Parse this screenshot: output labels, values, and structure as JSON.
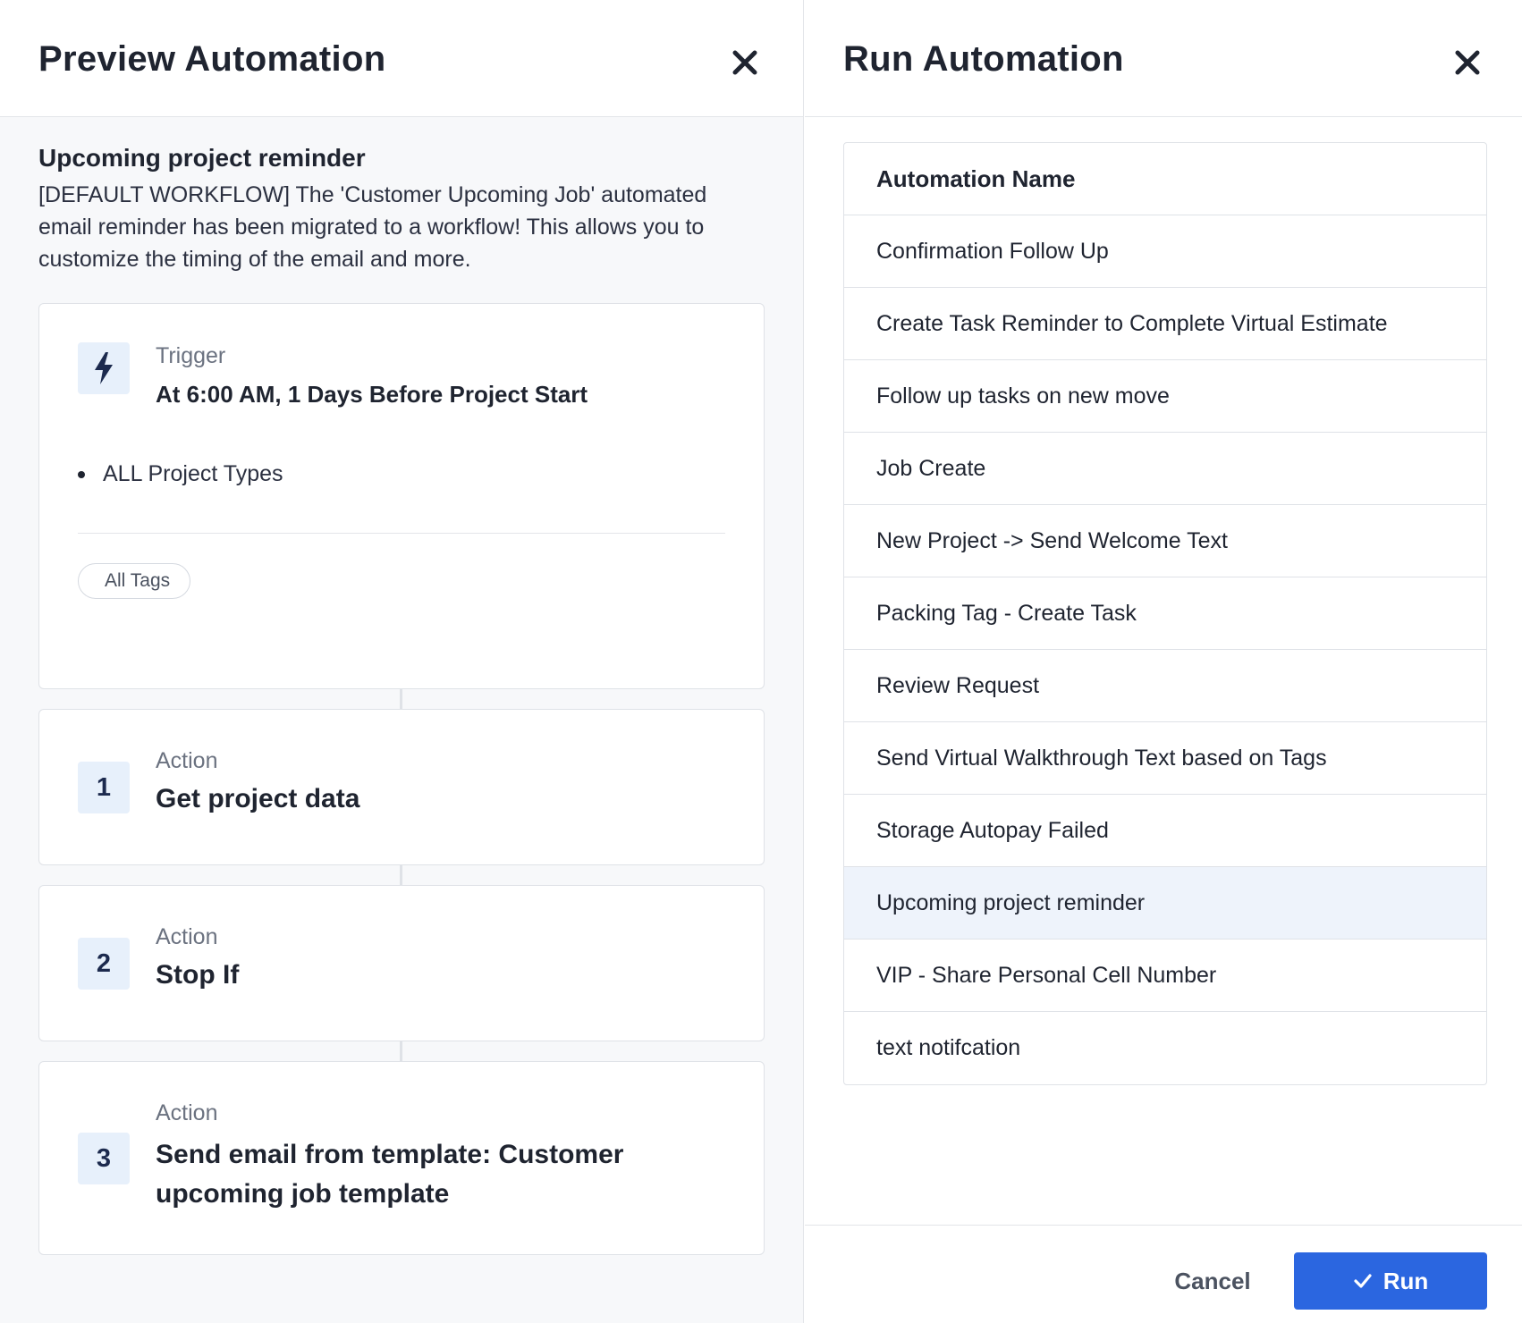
{
  "preview": {
    "title": "Preview Automation",
    "workflow_name": "Upcoming project reminder",
    "workflow_description": "[DEFAULT WORKFLOW] The 'Customer Upcoming Job' automated email reminder has been migrated to a workflow! This allows you to customize the timing of the email and more.",
    "trigger": {
      "kind_label": "Trigger",
      "name": "At 6:00 AM, 1 Days Before Project Start",
      "condition": "ALL Project Types",
      "tag": "All Tags",
      "icon": "lightning-bolt-icon"
    },
    "actions": [
      {
        "number": "1",
        "kind_label": "Action",
        "name": "Get project data"
      },
      {
        "number": "2",
        "kind_label": "Action",
        "name": "Stop If"
      },
      {
        "number": "3",
        "kind_label": "Action",
        "name": "Send email from template: Customer upcoming job template"
      }
    ]
  },
  "run": {
    "title": "Run Automation",
    "table_header": "Automation Name",
    "automations": [
      {
        "name": "Confirmation Follow Up",
        "selected": false
      },
      {
        "name": "Create Task Reminder to Complete Virtual Estimate",
        "selected": false
      },
      {
        "name": "Follow up tasks on new move",
        "selected": false
      },
      {
        "name": "Job Create",
        "selected": false
      },
      {
        "name": "New Project -> Send Welcome Text",
        "selected": false
      },
      {
        "name": "Packing Tag - Create Task",
        "selected": false
      },
      {
        "name": "Review Request",
        "selected": false
      },
      {
        "name": "Send Virtual Walkthrough Text based on Tags",
        "selected": false
      },
      {
        "name": "Storage Autopay Failed",
        "selected": false
      },
      {
        "name": "Upcoming project reminder",
        "selected": true
      },
      {
        "name": "VIP - Share Personal Cell Number",
        "selected": false
      },
      {
        "name": "text notifcation",
        "selected": false
      }
    ],
    "cancel_label": "Cancel",
    "run_label": "Run"
  },
  "colors": {
    "primary": "#2b66e0",
    "selected_row": "#eef3fb",
    "badge_bg": "#e7f0fb",
    "text_dark": "#1f2430"
  }
}
